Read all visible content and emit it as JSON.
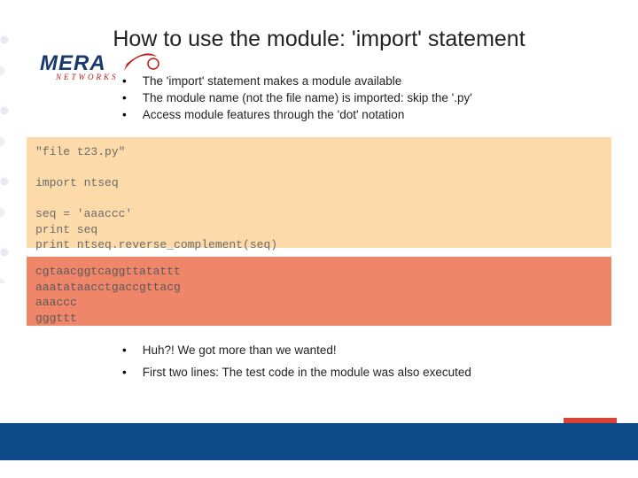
{
  "title": "How to use the module: 'import' statement",
  "logo": {
    "main": "MERA",
    "sub": "NETWORKS"
  },
  "bullets_top": [
    "The 'import' statement makes a module available",
    "The module name (not the file name) is imported: skip the '.py'",
    "Access module features through the 'dot' notation"
  ],
  "code_block_1": "\"file t23.py\"\n\nimport ntseq\n\nseq = 'aaaccc'\nprint seq\nprint ntseq.reverse_complement(seq)",
  "code_block_2": "cgtaacggtcaggttatattt\naaatataacctgaccgttacg\naaaccc\ngggttt",
  "bullets_bottom": [
    "Huh?! We got more than we wanted!",
    "First two lines: The test code in the module was also executed"
  ]
}
